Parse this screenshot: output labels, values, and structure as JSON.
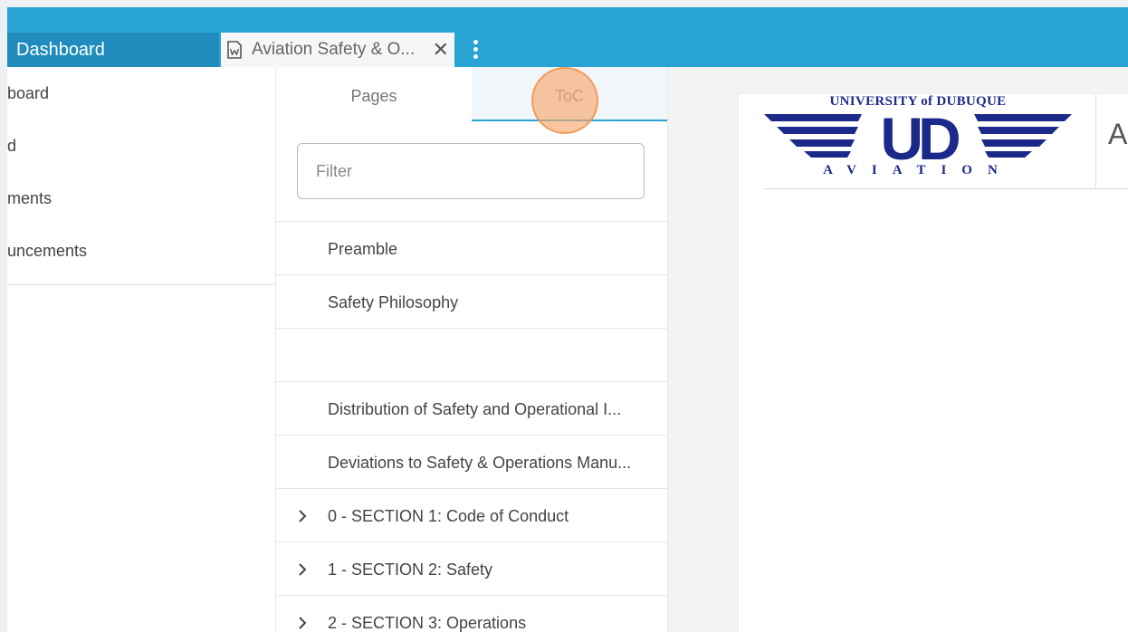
{
  "tabs": {
    "dashboard_label": "Dashboard",
    "document_label": "Aviation Safety & O...",
    "close_symbol": "✕"
  },
  "leftnav": {
    "items": [
      {
        "label": "board"
      },
      {
        "label": "d"
      },
      {
        "label": "ments"
      },
      {
        "label": "uncements"
      }
    ]
  },
  "panel": {
    "tab_pages": "Pages",
    "tab_toc": "ToC",
    "active_tab": "ToC",
    "filter_placeholder": "Filter",
    "items": [
      {
        "label": "Preamble",
        "expandable": false
      },
      {
        "label": "Safety Philosophy",
        "expandable": false
      },
      {
        "label": "",
        "expandable": false
      },
      {
        "label": "Distribution of Safety and Operational I...",
        "expandable": false
      },
      {
        "label": "Deviations to Safety & Operations Manu...",
        "expandable": false
      },
      {
        "label": "0 - SECTION 1: Code of Conduct",
        "expandable": true
      },
      {
        "label": "1 - SECTION 2: Safety",
        "expandable": true
      },
      {
        "label": "2 - SECTION 3: Operations",
        "expandable": true
      }
    ]
  },
  "document": {
    "logo_top": "UNIVERSITY of DUBUQUE",
    "logo_mark": "UD",
    "logo_bottom": "AVIATION",
    "header_letter": "A"
  },
  "colors": {
    "topbar": "#28a3d4",
    "dashboard_tab": "#1f8cbd",
    "logo_blue": "#1b2a8a",
    "click_indicator": "#f7a86e"
  }
}
